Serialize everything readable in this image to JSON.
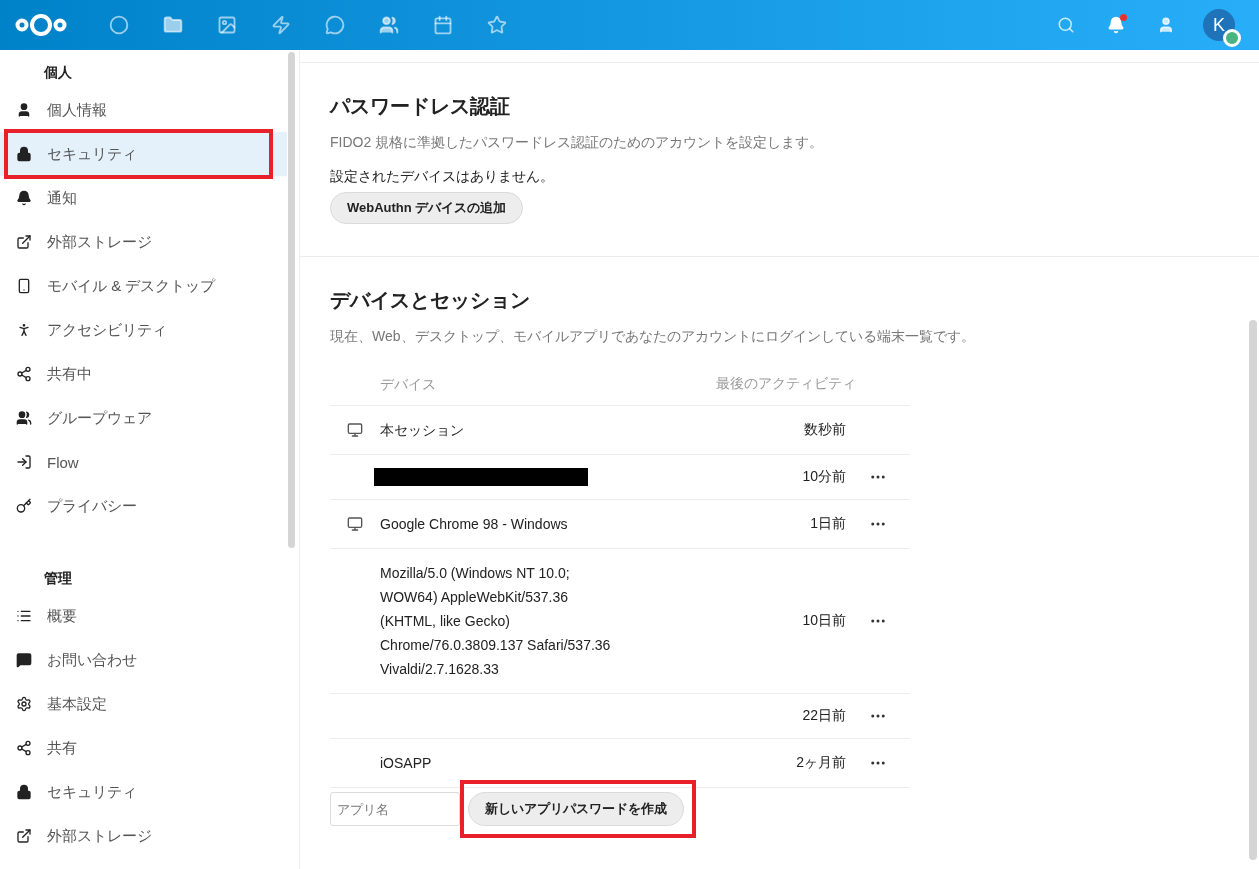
{
  "header": {
    "avatar_initial": "K",
    "notification_unread": true
  },
  "sidebar": {
    "groups": [
      {
        "title": "個人",
        "items": [
          {
            "label": "個人情報",
            "selected": false,
            "highlighted": false
          },
          {
            "label": "セキュリティ",
            "selected": true,
            "highlighted": true
          },
          {
            "label": "通知",
            "selected": false,
            "highlighted": false
          },
          {
            "label": "外部ストレージ",
            "selected": false,
            "highlighted": false
          },
          {
            "label": "モバイル & デスクトップ",
            "selected": false,
            "highlighted": false
          },
          {
            "label": "アクセシビリティ",
            "selected": false,
            "highlighted": false
          },
          {
            "label": "共有中",
            "selected": false,
            "highlighted": false
          },
          {
            "label": "グループウェア",
            "selected": false,
            "highlighted": false
          },
          {
            "label": "Flow",
            "selected": false,
            "highlighted": false
          },
          {
            "label": "プライバシー",
            "selected": false,
            "highlighted": false
          }
        ]
      },
      {
        "title": "管理",
        "items": [
          {
            "label": "概要",
            "selected": false,
            "highlighted": false
          },
          {
            "label": "お問い合わせ",
            "selected": false,
            "highlighted": false
          },
          {
            "label": "基本設定",
            "selected": false,
            "highlighted": false
          },
          {
            "label": "共有",
            "selected": false,
            "highlighted": false
          },
          {
            "label": "セキュリティ",
            "selected": false,
            "highlighted": false
          },
          {
            "label": "外部ストレージ",
            "selected": false,
            "highlighted": false
          }
        ]
      }
    ]
  },
  "passwordless": {
    "title": "パスワードレス認証",
    "description": "FIDO2 規格に準拠したパスワードレス認証のためのアカウントを設定します。",
    "status": "設定されたデバイスはありません。",
    "button": "WebAuthn デバイスの追加"
  },
  "sessions": {
    "title": "デバイスとセッション",
    "description": "現在、Web、デスクトップ、モバイルアプリであなたのアカウントにログインしている端末一覧です。",
    "columns": [
      "デバイス",
      "最後のアクティビティ"
    ],
    "rows": [
      {
        "kind": "desktop",
        "name": "本セッション",
        "time": "数秒前",
        "menu": false
      },
      {
        "kind": "redacted",
        "time": "10分前",
        "menu": true
      },
      {
        "kind": "desktop",
        "name": "Google Chrome 98 - Windows",
        "time": "1日前",
        "menu": true
      },
      {
        "kind": "plain",
        "name": "Mozilla/5.0 (Windows NT 10.0;\nWOW64) AppleWebKit/537.36\n(KHTML, like Gecko)\nChrome/76.0.3809.137 Safari/537.36\nVivaldi/2.7.1628.33",
        "time": "10日前",
        "menu": true
      },
      {
        "kind": "plain",
        "time": "22日前",
        "menu": true
      },
      {
        "kind": "plain",
        "name": "iOSAPP",
        "time": "2ヶ月前",
        "menu": true
      }
    ],
    "app_name_placeholder": "アプリ名",
    "create_button": "新しいアプリパスワードを作成",
    "create_highlighted": true
  }
}
